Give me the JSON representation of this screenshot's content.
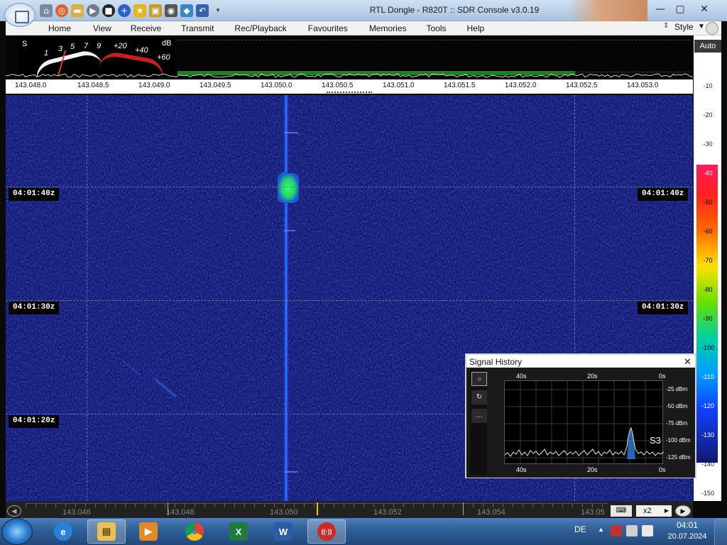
{
  "window": {
    "title": "RTL Dongle - R820T :: SDR Console v3.0.19",
    "minimize": "—",
    "maximize": "▢",
    "close": "✕"
  },
  "quick_access": [
    "home-icon",
    "lifebuoy-icon",
    "folder-icon",
    "play-icon",
    "stop-icon",
    "plus-icon",
    "star-icon",
    "lock-icon",
    "camera-icon",
    "drop-icon",
    "undo-icon"
  ],
  "menu": {
    "items": [
      "Home",
      "View",
      "Receive",
      "Transmit",
      "Rec/Playback",
      "Favourites",
      "Memories",
      "Tools",
      "Help"
    ],
    "style_label": "Style"
  },
  "meter": {
    "s_label": "S",
    "db_label": "dB",
    "ticks": [
      "1",
      "3",
      "5",
      "7",
      "9",
      "+20",
      "+40",
      "+60"
    ]
  },
  "frequency_scale": [
    "143.048.0",
    "143.048.5",
    "143.049.0",
    "143.049.5",
    "143.050.0",
    "143.050.5",
    "143.051.0",
    "143.051.5",
    "143.052.0",
    "143.052.5",
    "143.053.0"
  ],
  "db_scale": {
    "auto_label": "Auto",
    "labels": [
      "-10",
      "-20",
      "-30",
      "-40",
      "-50",
      "-60",
      "-70",
      "-80",
      "-90",
      "-100",
      "-110",
      "-120",
      "-130",
      "-140",
      "-150"
    ]
  },
  "waterfall": {
    "times": [
      "04:01:40z",
      "04:01:30z",
      "04:01:20z"
    ]
  },
  "bottom_bar": {
    "freq_labels": [
      "143.046",
      "143.048",
      "143.050",
      "143.052",
      "143.054",
      "143.05"
    ],
    "zoom": "x2"
  },
  "signal_history": {
    "title": "Signal History",
    "close": "✕",
    "top_axis": [
      "40s",
      "20s",
      "0s"
    ],
    "bottom_axis": [
      "40s",
      "20s",
      "0s"
    ],
    "db_axis": [
      "-25 dBm",
      "-50 dBm",
      "-75 dBm",
      "-100 dBm",
      "-125 dBm"
    ],
    "s_reading": "S3",
    "tools": [
      "○",
      "↻",
      "…"
    ]
  },
  "taskbar": {
    "apps": [
      "ie-icon",
      "explorer-icon",
      "media-player-icon",
      "chrome-icon",
      "excel-icon",
      "word-icon",
      "sdr-console-icon"
    ],
    "app_glyphs": [
      "e",
      "▤",
      "▶",
      "●",
      "X",
      "W",
      "((·))"
    ],
    "language": "DE",
    "time": "04:01",
    "date": "20.07.2024"
  }
}
